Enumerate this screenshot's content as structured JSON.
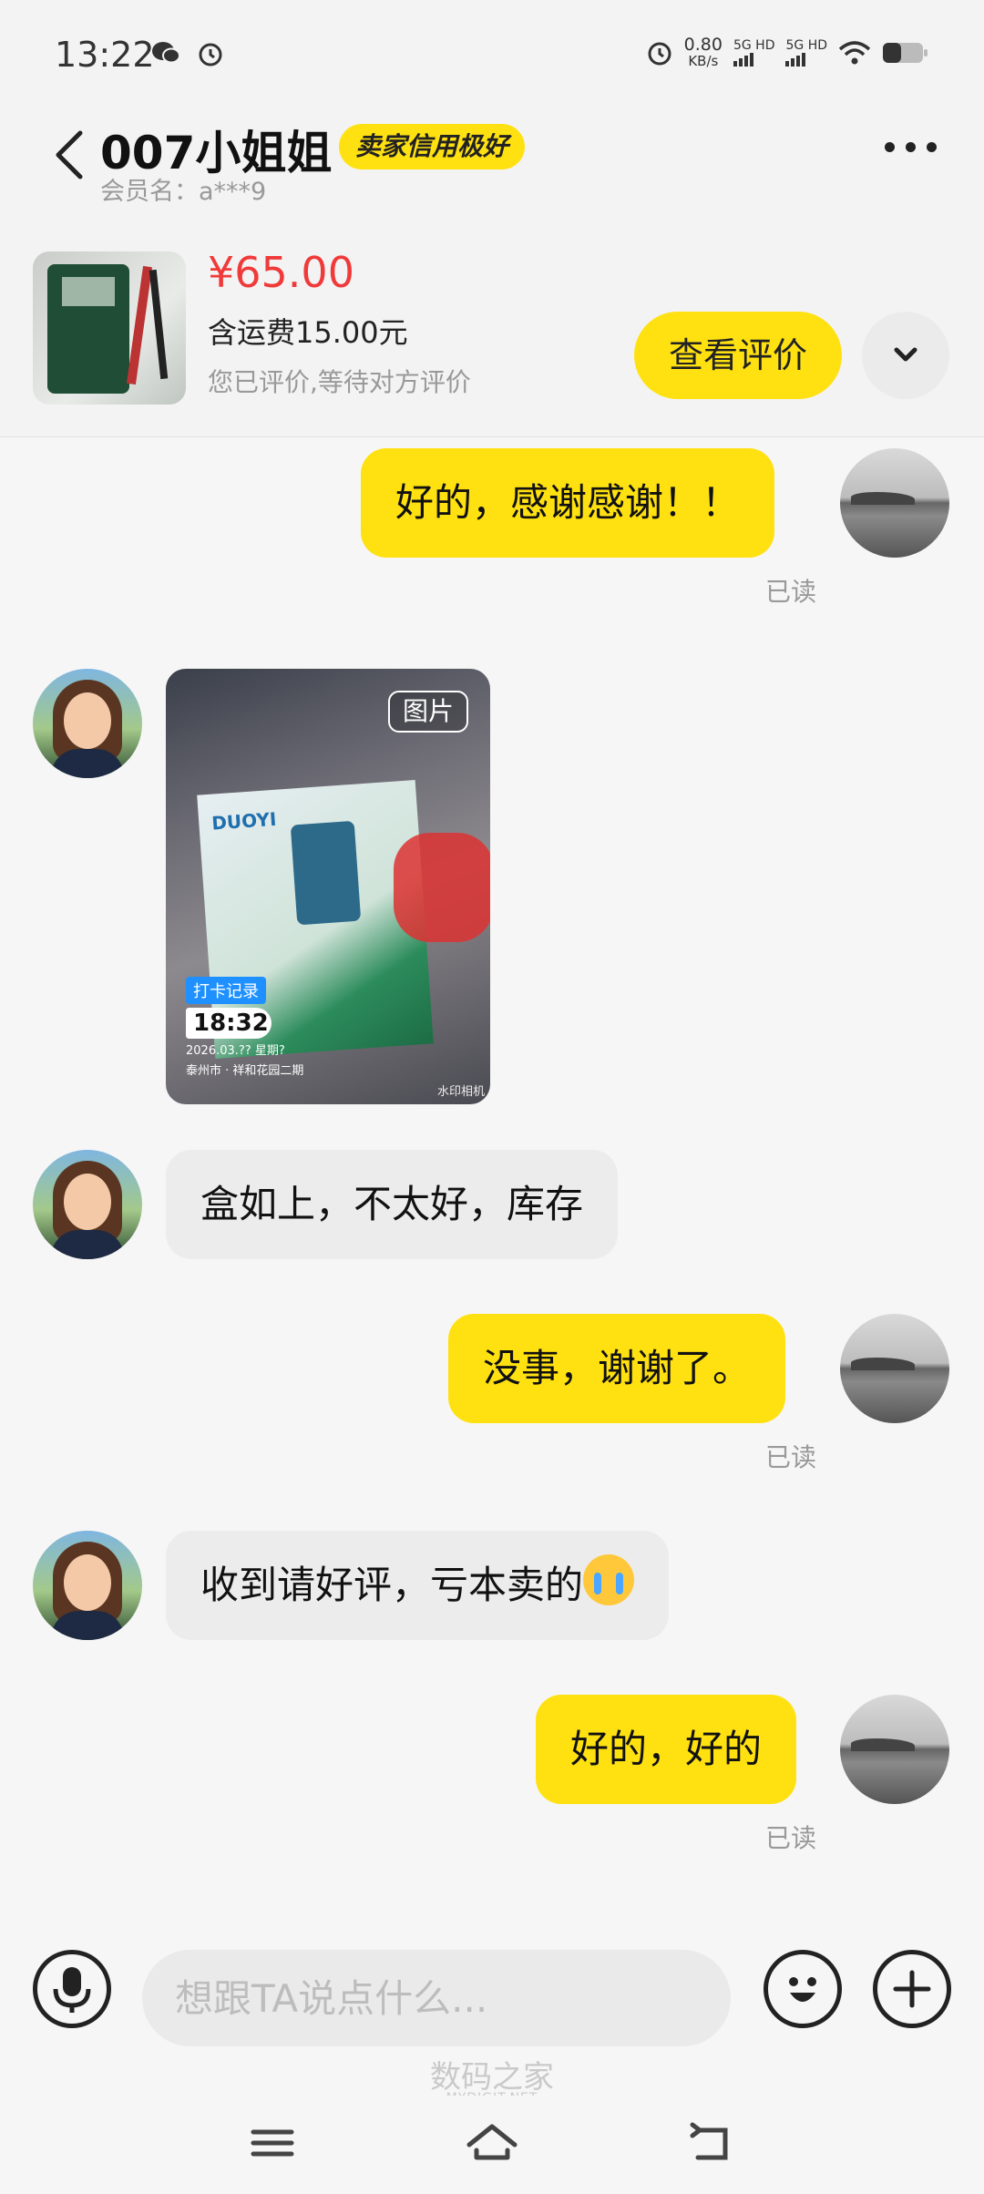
{
  "status_bar": {
    "time": "13:22",
    "speed_value": "0.80",
    "speed_unit": "KB/s",
    "network_1": "5G HD",
    "network_2": "5G HD",
    "icons": [
      "wechat-icon",
      "alarm-icon",
      "alarm-icon",
      "signal-icon",
      "wifi-icon",
      "battery-icon"
    ]
  },
  "header": {
    "title": "007小姐姐",
    "badge": "卖家信用极好",
    "subtitle": "会员名：a***9"
  },
  "product": {
    "price": "¥65.00",
    "shipping": "含运费15.00元",
    "status": "您已评价,等待对方评价",
    "review_button": "查看评价"
  },
  "messages": [
    {
      "side": "out",
      "text": "好的，感谢感谢！！",
      "read": "已读"
    },
    {
      "side": "in",
      "type": "image",
      "tag": "图片",
      "checkin_label": "打卡记录",
      "checkin_time": "18:32",
      "checkin_date": "2026.03.?? 星期?",
      "checkin_place": "泰州市 · 祥和花园二期",
      "watermark": "水印相机"
    },
    {
      "side": "in",
      "text": "盒如上，不太好，库存"
    },
    {
      "side": "out",
      "text": "没事，谢谢了。",
      "read": "已读"
    },
    {
      "side": "in",
      "text": "收到请好评，亏本卖的"
    },
    {
      "side": "out",
      "text": "好的，好的",
      "read": "已读"
    }
  ],
  "input": {
    "placeholder": "想跟TA说点什么..."
  },
  "watermark": {
    "cn": "数码之家",
    "en": "MYDIGIT.NET"
  },
  "colors": {
    "accent": "#ffe111",
    "price": "#f03a3a",
    "muted": "#999999"
  }
}
